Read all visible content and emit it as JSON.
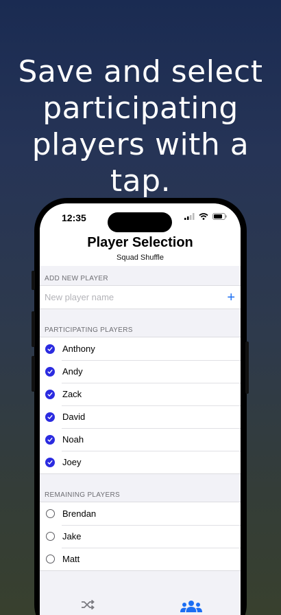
{
  "headline": "Save and select participating players with a tap.",
  "status_bar": {
    "time": "12:35"
  },
  "nav": {
    "title": "Player Selection",
    "subtitle": "Squad Shuffle"
  },
  "add_section": {
    "header": "ADD NEW PLAYER",
    "placeholder": "New player name",
    "add_icon": "plus-icon"
  },
  "participating": {
    "header": "PARTICIPATING PLAYERS",
    "players": [
      "Anthony",
      "Andy",
      "Zack",
      "David",
      "Noah",
      "Joey"
    ]
  },
  "remaining": {
    "header": "REMAINING PLAYERS",
    "players": [
      "Brendan",
      "Jake",
      "Matt"
    ]
  },
  "tabs": [
    {
      "icon": "shuffle-icon",
      "selected": false
    },
    {
      "icon": "players-icon",
      "selected": true
    }
  ],
  "colors": {
    "accent": "#1b6ef3",
    "checkmark": "#2b2be0"
  }
}
